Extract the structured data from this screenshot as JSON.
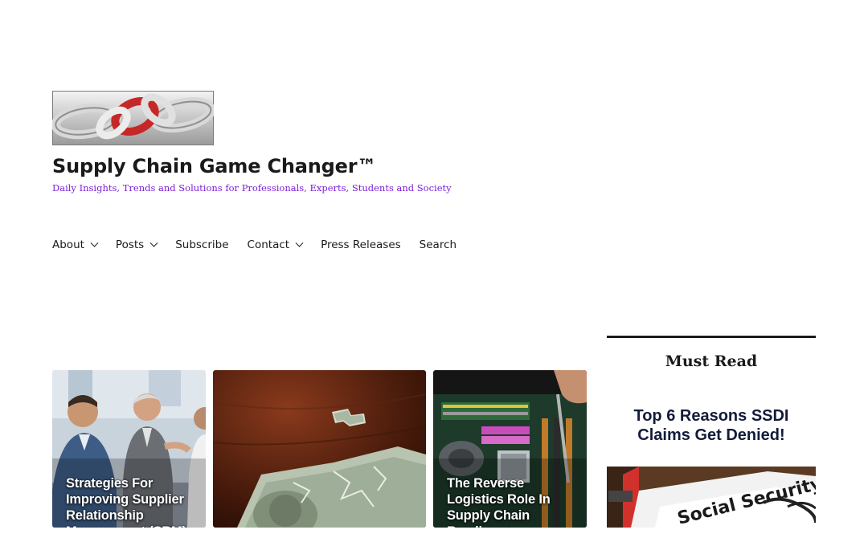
{
  "site": {
    "title": "Supply Chain Game Changer™",
    "tagline": "Daily Insights, Trends and Solutions for Professionals, Experts, Students and Society"
  },
  "nav": {
    "items": [
      {
        "label": "About",
        "has_dropdown": true
      },
      {
        "label": "Posts",
        "has_dropdown": true
      },
      {
        "label": "Subscribe",
        "has_dropdown": false
      },
      {
        "label": "Contact",
        "has_dropdown": true
      },
      {
        "label": "Press Releases",
        "has_dropdown": false
      },
      {
        "label": "Search",
        "has_dropdown": false
      }
    ]
  },
  "cards": [
    {
      "title": "Strategies For Improving Supplier Relationship Management (SRM)"
    },
    {
      "title": ""
    },
    {
      "title": "The Reverse Logistics Role In Supply Chain Readiness"
    }
  ],
  "sidebar": {
    "heading": "Must Read",
    "featured_title": "Top 6 Reasons SSDI Claims Get Denied!",
    "image_text": "Social Security"
  },
  "colors": {
    "text": "#1a1a1a",
    "tagline": "#7b1fd8",
    "featured_title": "#131b3a",
    "chain_accent": "#c62828"
  }
}
